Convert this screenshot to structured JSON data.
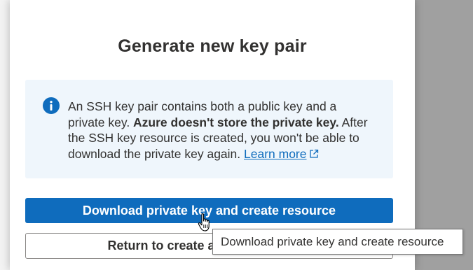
{
  "dialog": {
    "title": "Generate new key pair",
    "info": {
      "icon": "info-icon",
      "text_part1": "An SSH key pair contains both a public key and a private key. ",
      "text_bold": "Azure doesn't store the private key.",
      "text_part2": " After the SSH key resource is created, you won't be able to download the private key again. ",
      "learn_more": "Learn more",
      "link_icon": "external-link-icon"
    },
    "primary_button": "Download private key and create resource",
    "secondary_button": "Return to create a virtual machine",
    "tooltip": "Download private key and create resource"
  },
  "colors": {
    "accent": "#0f6cbd",
    "info_background": "#eff6fc",
    "text": "#323130"
  }
}
